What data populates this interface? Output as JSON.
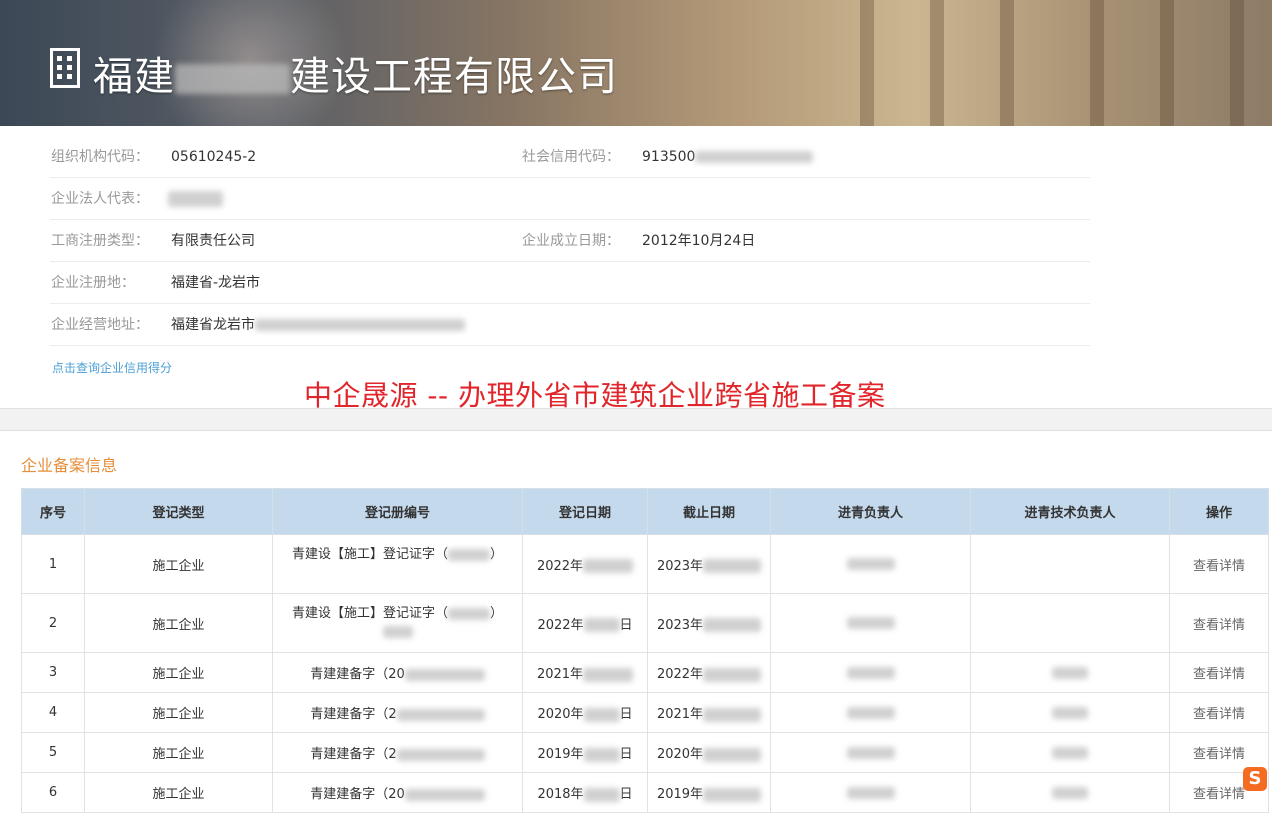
{
  "header": {
    "company_name_prefix": "福建",
    "company_name_suffix": "建设工程有限公司",
    "icon": "building-icon"
  },
  "info": {
    "org_code_label": "组织机构代码：",
    "org_code_value": "05610245-2",
    "credit_code_label": "社会信用代码：",
    "credit_code_value": "913500",
    "legal_rep_label": "企业法人代表：",
    "reg_type_label": "工商注册类型：",
    "reg_type_value": "有限责任公司",
    "founded_label": "企业成立日期：",
    "founded_value": "2012年10月24日",
    "reg_place_label": "企业注册地：",
    "reg_place_value": "福建省-龙岩市",
    "address_label": "企业经营地址：",
    "address_value": "福建省龙岩市",
    "credit_link": "点击查询企业信用得分"
  },
  "watermark": "中企晟源 -- 办理外省市建筑企业跨省施工备案",
  "records": {
    "title": "企业备案信息",
    "headers": [
      "序号",
      "登记类型",
      "登记册编号",
      "登记日期",
      "截止日期",
      "进青负责人",
      "进青技术负责人",
      "操作"
    ],
    "rows": [
      {
        "no": "1",
        "type": "施工企业",
        "reg_no": "青建设【施工】登记证字（",
        "reg_date": "2022年",
        "end_date": "2023年",
        "action": "查看详情"
      },
      {
        "no": "2",
        "type": "施工企业",
        "reg_no": "青建设【施工】登记证字（",
        "reg_date": "2022年",
        "end_date": "2023年",
        "action": "查看详情"
      },
      {
        "no": "3",
        "type": "施工企业",
        "reg_no": "青建建备字（20",
        "reg_date": "2021年",
        "end_date": "2022年",
        "action": "查看详情"
      },
      {
        "no": "4",
        "type": "施工企业",
        "reg_no": "青建建备字（2",
        "reg_date": "2020年",
        "end_date": "2021年",
        "action": "查看详情"
      },
      {
        "no": "5",
        "type": "施工企业",
        "reg_no": "青建建备字（2",
        "reg_date": "2019年",
        "end_date": "2020年",
        "action": "查看详情"
      },
      {
        "no": "6",
        "type": "施工企业",
        "reg_no": "青建建备字（20",
        "reg_date": "2018年",
        "end_date": "2019年",
        "action": "查看详情"
      }
    ],
    "date_suffix": "日"
  },
  "tray": {
    "sogou_glyph": "S"
  }
}
